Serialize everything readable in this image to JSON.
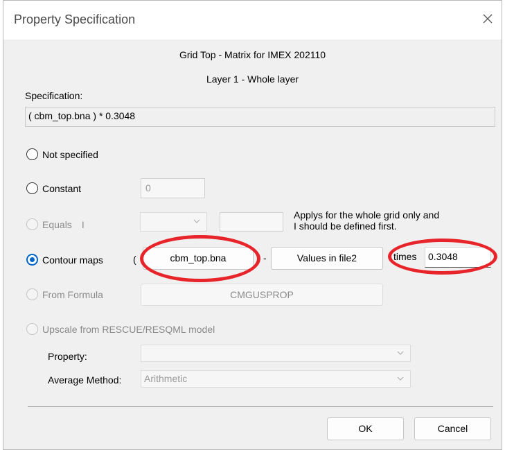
{
  "window": {
    "title": "Property Specification"
  },
  "header": {
    "line1": "Grid Top - Matrix for IMEX 202110",
    "line2": "Layer 1 - Whole layer"
  },
  "specification": {
    "label": "Specification:",
    "value": "( cbm_top.bna ) * 0.3048"
  },
  "options": {
    "not_specified": "Not specified",
    "constant": {
      "label": "Constant",
      "value": "0"
    },
    "equals": {
      "label": "Equals",
      "suffix": "I",
      "note_line1": "Applys for the whole grid only and",
      "note_line2": "I should be defined first."
    },
    "contour_maps": {
      "label": "Contour maps",
      "open_paren": "(",
      "file_button": "cbm_top.bna",
      "dash": "-",
      "file2_button": "Values in file2",
      "times_label": "times",
      "times_value": "0.3048"
    },
    "from_formula": {
      "label": "From Formula",
      "button": "CMGUSPROP"
    },
    "upscale": {
      "label": "Upscale from RESCUE/RESQML model",
      "property_label": "Property:",
      "property_value": "",
      "average_label": "Average Method:",
      "average_value": "Arithmetic"
    }
  },
  "footer": {
    "ok": "OK",
    "cancel": "Cancel"
  },
  "colors": {
    "accent": "#0064c8",
    "highlight": "#e8242b"
  }
}
